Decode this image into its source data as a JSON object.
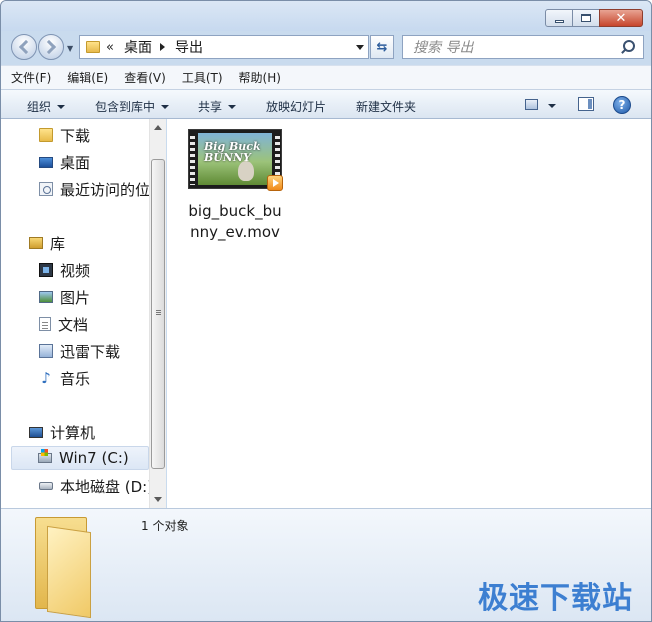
{
  "window": {
    "caption_close": "✕"
  },
  "address": {
    "chevron": "«",
    "crumbs": [
      "桌面",
      "导出"
    ]
  },
  "search": {
    "placeholder": "搜索 导出"
  },
  "menubar": {
    "items": [
      "文件(F)",
      "编辑(E)",
      "查看(V)",
      "工具(T)",
      "帮助(H)"
    ]
  },
  "toolbar": {
    "organize": "组织",
    "include_in_library": "包含到库中",
    "share": "共享",
    "slideshow": "放映幻灯片",
    "new_folder": "新建文件夹",
    "help": "?"
  },
  "nav": {
    "favorites": [
      "下载",
      "桌面",
      "最近访问的位置"
    ],
    "libraries_header": "库",
    "libraries": [
      "视频",
      "图片",
      "文档",
      "迅雷下载",
      "音乐"
    ],
    "computer_header": "计算机",
    "drives": [
      "Win7 (C:)",
      "本地磁盘 (D:)"
    ],
    "selected": "Win7 (C:)"
  },
  "content": {
    "files": [
      {
        "name": "big_buck_bunny_ev.mov",
        "thumb_title": "Big Buck BUNNY",
        "icon": "video-thumbnail-icon"
      }
    ]
  },
  "details": {
    "status": "1 个对象"
  },
  "watermark": "极速下载站",
  "colors": {
    "accent": "#3d7fd1",
    "frame": "#c9dbee",
    "close_button": "#c7452c"
  }
}
